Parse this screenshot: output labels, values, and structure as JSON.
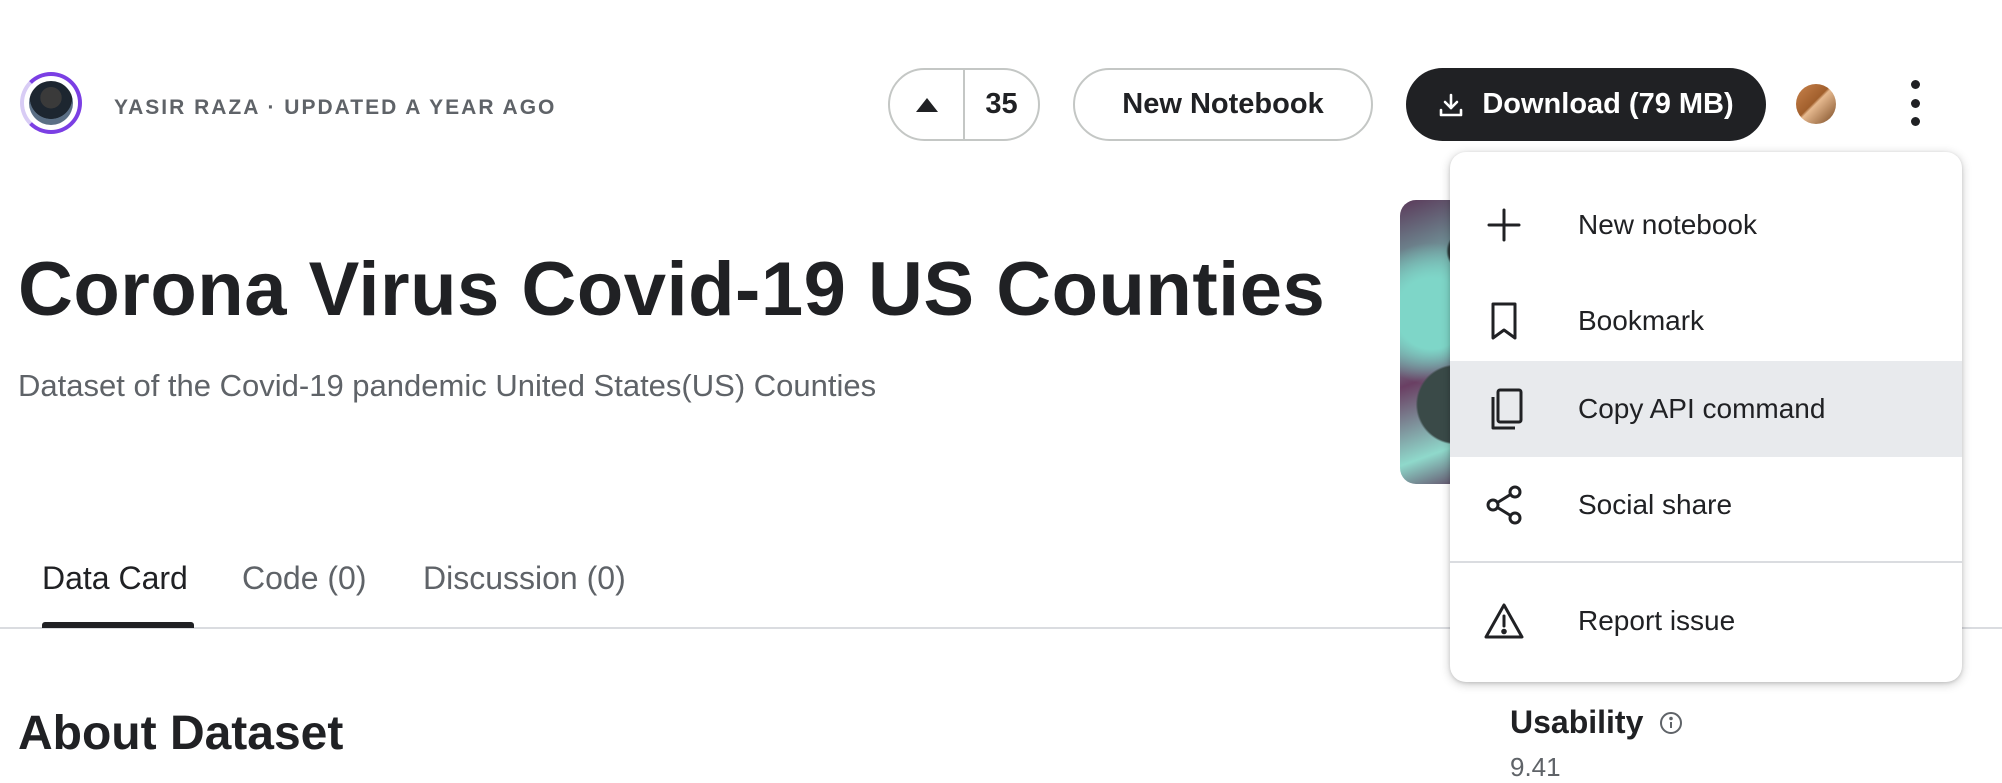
{
  "header": {
    "byline": "YASIR RAZA · UPDATED A YEAR AGO",
    "upvote_count": "35",
    "new_notebook_label": "New Notebook",
    "download_label": "Download (79 MB)"
  },
  "dataset": {
    "title": "Corona Virus Covid-19 US Counties",
    "subtitle": "Dataset of the Covid-19 pandemic United States(US) Counties"
  },
  "tabs": [
    {
      "label": "Data Card",
      "active": true
    },
    {
      "label": "Code (0)",
      "active": false
    },
    {
      "label": "Discussion (0)",
      "active": false
    }
  ],
  "about": {
    "heading": "About Dataset"
  },
  "usability": {
    "label": "Usability",
    "value": "9.41"
  },
  "menu": {
    "items": [
      {
        "label": "New notebook",
        "icon": "plus-icon"
      },
      {
        "label": "Bookmark",
        "icon": "bookmark-icon"
      },
      {
        "label": "Copy API command",
        "icon": "copy-icon",
        "highlighted": true
      },
      {
        "label": "Social share",
        "icon": "share-icon"
      },
      {
        "label": "Report issue",
        "icon": "warning-icon"
      }
    ]
  },
  "colors": {
    "primary_dark": "#202124",
    "muted_text": "#5f6368",
    "border": "#c4c7c5",
    "menu_highlight": "#e8eaed",
    "avatar_ring": "#7b3fe4"
  }
}
